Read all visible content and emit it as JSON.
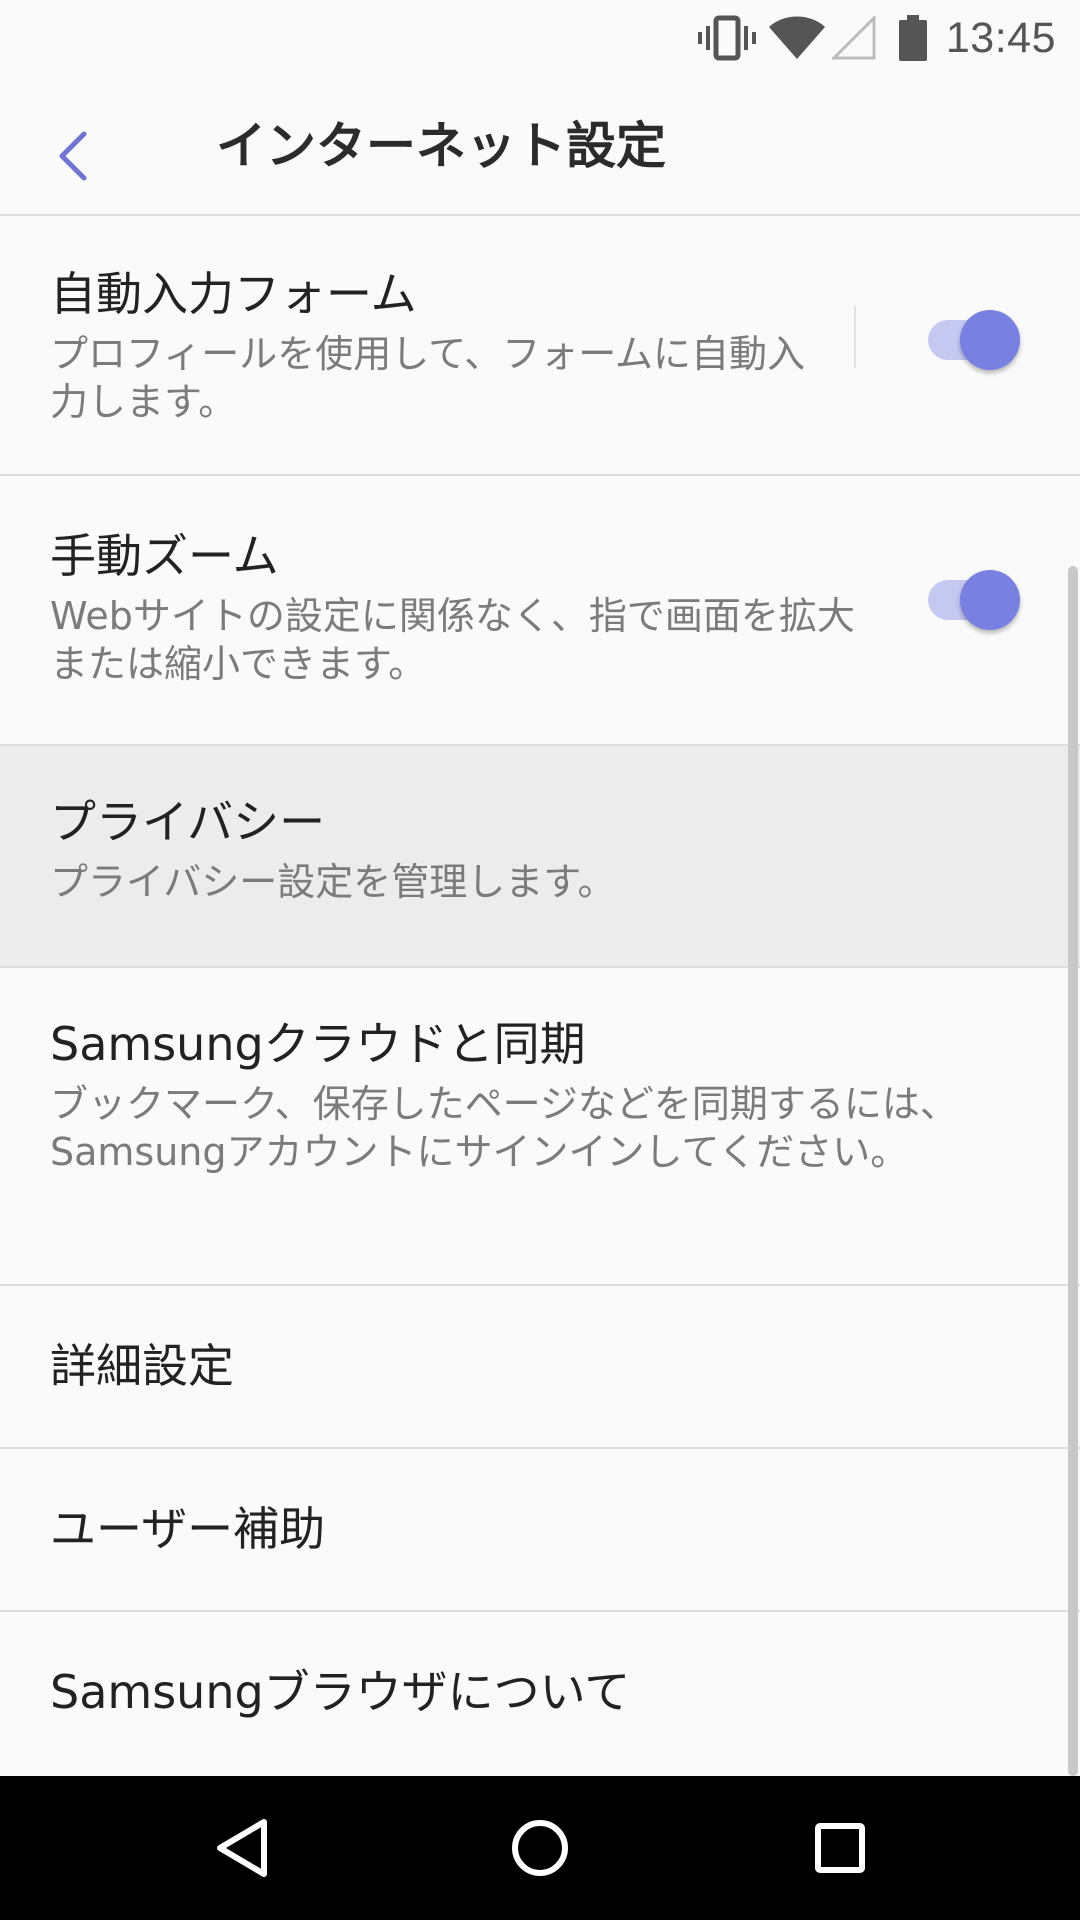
{
  "status_bar": {
    "time": "13:45",
    "icons": [
      "vibrate-icon",
      "wifi-icon",
      "cell-signal-icon",
      "battery-icon"
    ]
  },
  "app_bar": {
    "back_icon": "chevron-left-icon",
    "title": "インターネット設定"
  },
  "settings": [
    {
      "title": "自動入力フォーム",
      "summary": "プロフィールを使用して、フォームに自動入力します。",
      "toggle_on": true
    },
    {
      "title": "手動ズーム",
      "summary": "Webサイトの設定に関係なく、指で画面を拡大または縮小できます。",
      "toggle_on": true
    },
    {
      "title": "プライバシー",
      "summary": "プライバシー設定を管理します。",
      "highlighted": true
    },
    {
      "title": "Samsungクラウドと同期",
      "summary": "ブックマーク、保存したページなどを同期するには、Samsungアカウントにサインインしてください。"
    },
    {
      "title": "詳細設定"
    },
    {
      "title": "ユーザー補助"
    },
    {
      "title": "Samsungブラウザについて"
    }
  ],
  "nav_bar": {
    "icons": [
      "nav-back-icon",
      "nav-home-icon",
      "nav-recents-icon"
    ]
  },
  "colors": {
    "accent": "#7880e2",
    "accent_track": "#c5c9f1",
    "back_arrow": "#6f74d6",
    "highlight_bg": "#ececec"
  }
}
